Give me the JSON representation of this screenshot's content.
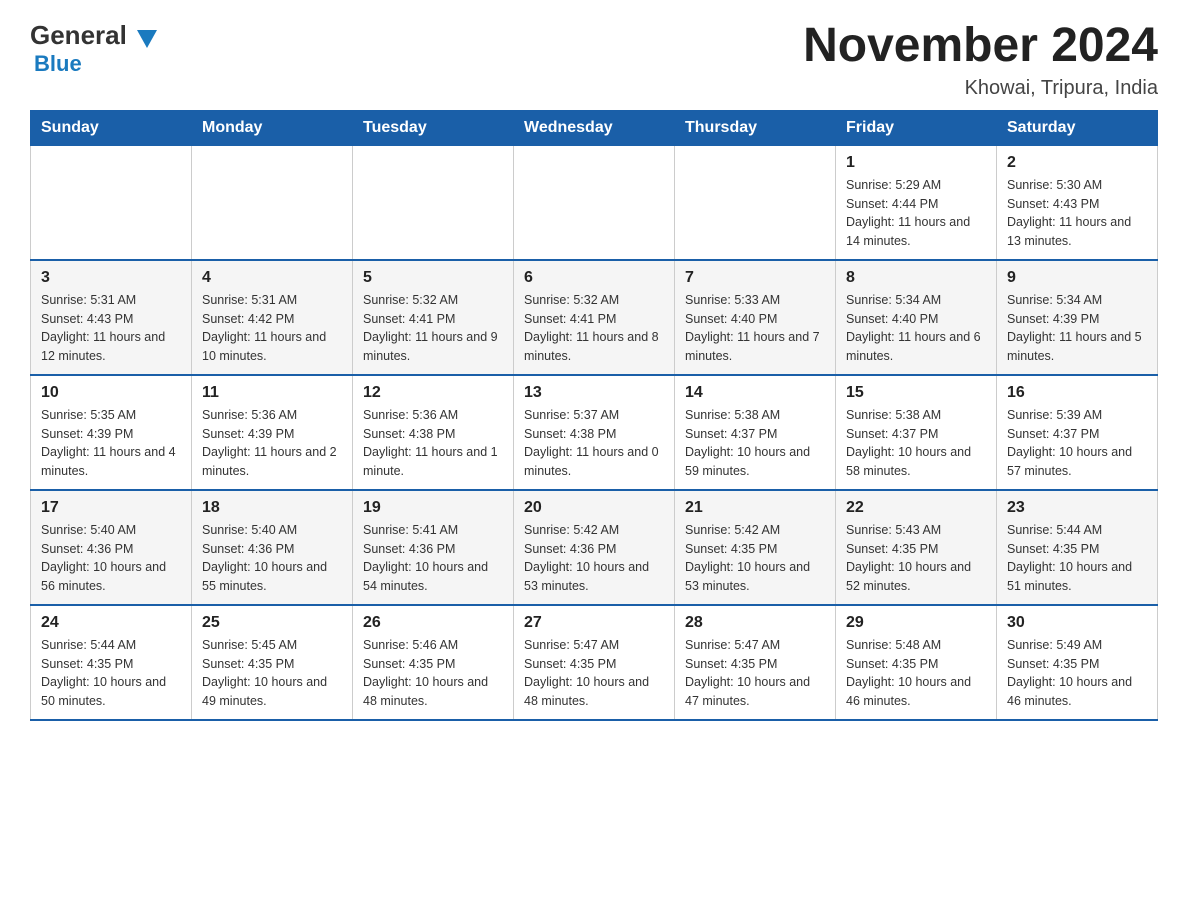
{
  "header": {
    "logo": {
      "general": "General",
      "blue": "Blue"
    },
    "title": "November 2024",
    "location": "Khowai, Tripura, India"
  },
  "weekdays": [
    "Sunday",
    "Monday",
    "Tuesday",
    "Wednesday",
    "Thursday",
    "Friday",
    "Saturday"
  ],
  "weeks": [
    [
      {
        "day": "",
        "info": ""
      },
      {
        "day": "",
        "info": ""
      },
      {
        "day": "",
        "info": ""
      },
      {
        "day": "",
        "info": ""
      },
      {
        "day": "",
        "info": ""
      },
      {
        "day": "1",
        "info": "Sunrise: 5:29 AM\nSunset: 4:44 PM\nDaylight: 11 hours and 14 minutes."
      },
      {
        "day": "2",
        "info": "Sunrise: 5:30 AM\nSunset: 4:43 PM\nDaylight: 11 hours and 13 minutes."
      }
    ],
    [
      {
        "day": "3",
        "info": "Sunrise: 5:31 AM\nSunset: 4:43 PM\nDaylight: 11 hours and 12 minutes."
      },
      {
        "day": "4",
        "info": "Sunrise: 5:31 AM\nSunset: 4:42 PM\nDaylight: 11 hours and 10 minutes."
      },
      {
        "day": "5",
        "info": "Sunrise: 5:32 AM\nSunset: 4:41 PM\nDaylight: 11 hours and 9 minutes."
      },
      {
        "day": "6",
        "info": "Sunrise: 5:32 AM\nSunset: 4:41 PM\nDaylight: 11 hours and 8 minutes."
      },
      {
        "day": "7",
        "info": "Sunrise: 5:33 AM\nSunset: 4:40 PM\nDaylight: 11 hours and 7 minutes."
      },
      {
        "day": "8",
        "info": "Sunrise: 5:34 AM\nSunset: 4:40 PM\nDaylight: 11 hours and 6 minutes."
      },
      {
        "day": "9",
        "info": "Sunrise: 5:34 AM\nSunset: 4:39 PM\nDaylight: 11 hours and 5 minutes."
      }
    ],
    [
      {
        "day": "10",
        "info": "Sunrise: 5:35 AM\nSunset: 4:39 PM\nDaylight: 11 hours and 4 minutes."
      },
      {
        "day": "11",
        "info": "Sunrise: 5:36 AM\nSunset: 4:39 PM\nDaylight: 11 hours and 2 minutes."
      },
      {
        "day": "12",
        "info": "Sunrise: 5:36 AM\nSunset: 4:38 PM\nDaylight: 11 hours and 1 minute."
      },
      {
        "day": "13",
        "info": "Sunrise: 5:37 AM\nSunset: 4:38 PM\nDaylight: 11 hours and 0 minutes."
      },
      {
        "day": "14",
        "info": "Sunrise: 5:38 AM\nSunset: 4:37 PM\nDaylight: 10 hours and 59 minutes."
      },
      {
        "day": "15",
        "info": "Sunrise: 5:38 AM\nSunset: 4:37 PM\nDaylight: 10 hours and 58 minutes."
      },
      {
        "day": "16",
        "info": "Sunrise: 5:39 AM\nSunset: 4:37 PM\nDaylight: 10 hours and 57 minutes."
      }
    ],
    [
      {
        "day": "17",
        "info": "Sunrise: 5:40 AM\nSunset: 4:36 PM\nDaylight: 10 hours and 56 minutes."
      },
      {
        "day": "18",
        "info": "Sunrise: 5:40 AM\nSunset: 4:36 PM\nDaylight: 10 hours and 55 minutes."
      },
      {
        "day": "19",
        "info": "Sunrise: 5:41 AM\nSunset: 4:36 PM\nDaylight: 10 hours and 54 minutes."
      },
      {
        "day": "20",
        "info": "Sunrise: 5:42 AM\nSunset: 4:36 PM\nDaylight: 10 hours and 53 minutes."
      },
      {
        "day": "21",
        "info": "Sunrise: 5:42 AM\nSunset: 4:35 PM\nDaylight: 10 hours and 53 minutes."
      },
      {
        "day": "22",
        "info": "Sunrise: 5:43 AM\nSunset: 4:35 PM\nDaylight: 10 hours and 52 minutes."
      },
      {
        "day": "23",
        "info": "Sunrise: 5:44 AM\nSunset: 4:35 PM\nDaylight: 10 hours and 51 minutes."
      }
    ],
    [
      {
        "day": "24",
        "info": "Sunrise: 5:44 AM\nSunset: 4:35 PM\nDaylight: 10 hours and 50 minutes."
      },
      {
        "day": "25",
        "info": "Sunrise: 5:45 AM\nSunset: 4:35 PM\nDaylight: 10 hours and 49 minutes."
      },
      {
        "day": "26",
        "info": "Sunrise: 5:46 AM\nSunset: 4:35 PM\nDaylight: 10 hours and 48 minutes."
      },
      {
        "day": "27",
        "info": "Sunrise: 5:47 AM\nSunset: 4:35 PM\nDaylight: 10 hours and 48 minutes."
      },
      {
        "day": "28",
        "info": "Sunrise: 5:47 AM\nSunset: 4:35 PM\nDaylight: 10 hours and 47 minutes."
      },
      {
        "day": "29",
        "info": "Sunrise: 5:48 AM\nSunset: 4:35 PM\nDaylight: 10 hours and 46 minutes."
      },
      {
        "day": "30",
        "info": "Sunrise: 5:49 AM\nSunset: 4:35 PM\nDaylight: 10 hours and 46 minutes."
      }
    ]
  ]
}
